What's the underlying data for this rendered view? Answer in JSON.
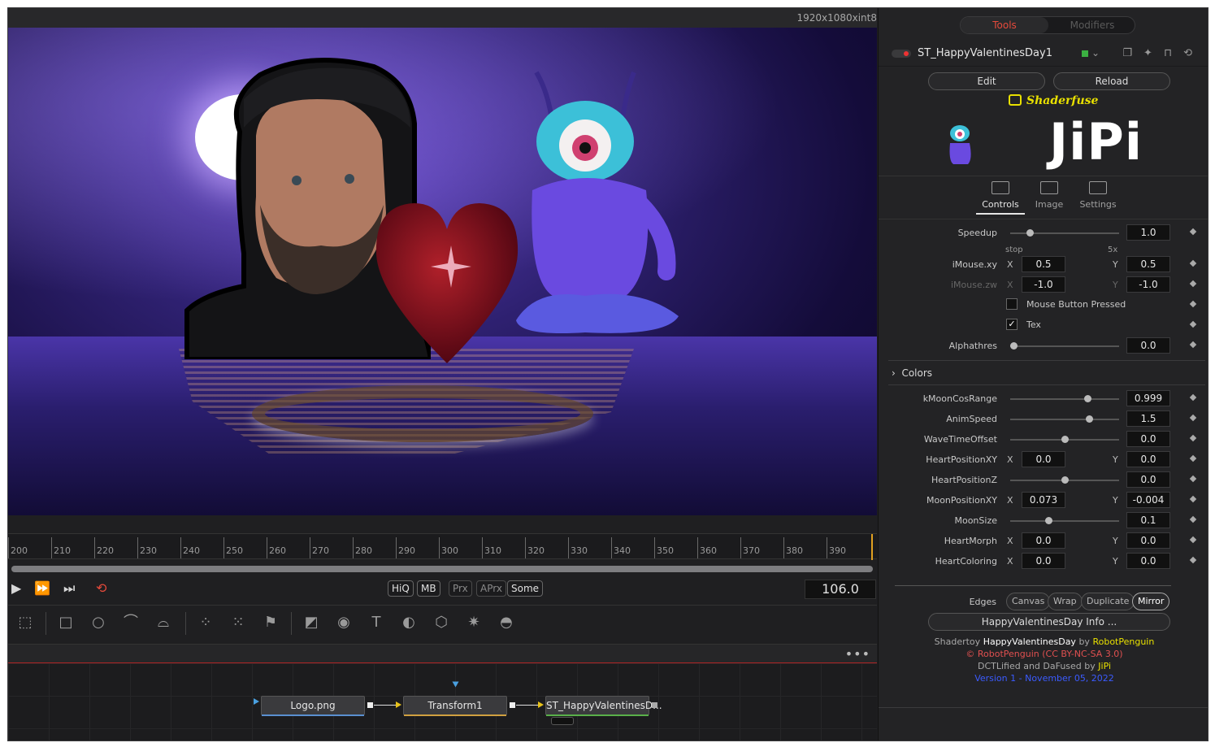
{
  "viewer": {
    "resolution": "1920x1080xint8",
    "ruler_ticks": [
      "200",
      "210",
      "220",
      "230",
      "240",
      "250",
      "260",
      "270",
      "280",
      "290",
      "300",
      "310",
      "320",
      "330",
      "340",
      "350",
      "360",
      "370",
      "380",
      "390"
    ]
  },
  "transport": {
    "buttons": [
      "HiQ",
      "MB",
      "Prx",
      "APrx",
      "Some"
    ],
    "frame": "106.0"
  },
  "flow": {
    "nodes": [
      {
        "label": "Logo.png",
        "color": "#5a8fd0"
      },
      {
        "label": "Transform1",
        "color": "#d0a040"
      },
      {
        "label": "ST_HappyValentinesD...",
        "color": "#5ab04a"
      }
    ]
  },
  "inspector": {
    "tabs": [
      "Tools",
      "Modifiers"
    ],
    "node_name": "ST_HappyValentinesDay1",
    "edit_label": "Edit",
    "reload_label": "Reload",
    "shaderfuse_label": "Shaderfuse",
    "logo_text": "JiPi",
    "subtabs": [
      "Controls",
      "Image",
      "Settings"
    ],
    "speedup": {
      "label": "Speedup",
      "value": "1.0",
      "min_label": "stop",
      "max_label": "5x",
      "level": 0.16
    },
    "imouse_xy": {
      "label": "iMouse.xy",
      "x": "0.5",
      "y": "0.5"
    },
    "imouse_zw": {
      "label": "iMouse.zw",
      "x": "-1.0",
      "y": "-1.0"
    },
    "mouse_pressed": {
      "label": "Mouse Button Pressed",
      "checked": false
    },
    "tex": {
      "label": "Tex",
      "checked": true
    },
    "alphathres": {
      "label": "Alphathres",
      "value": "0.0",
      "level": 0.0
    },
    "colors_section": "Colors",
    "params": [
      {
        "label": "kMoonCosRange",
        "type": "slider",
        "value": "0.999",
        "level": 0.73
      },
      {
        "label": "AnimSpeed",
        "type": "slider",
        "value": "1.5",
        "level": 0.74
      },
      {
        "label": "WaveTimeOffset",
        "type": "slider",
        "value": "0.0",
        "level": 0.5
      },
      {
        "label": "HeartPositionXY",
        "type": "xy",
        "x": "0.0",
        "y": "0.0"
      },
      {
        "label": "HeartPositionZ",
        "type": "slider",
        "value": "0.0",
        "level": 0.5
      },
      {
        "label": "MoonPositionXY",
        "type": "xy",
        "x": "0.073",
        "y": "-0.004"
      },
      {
        "label": "MoonSize",
        "type": "slider",
        "value": "0.1",
        "level": 0.34
      },
      {
        "label": "HeartMorph",
        "type": "xy",
        "x": "0.0",
        "y": "0.0"
      },
      {
        "label": "HeartColoring",
        "type": "xy",
        "x": "0.0",
        "y": "0.0"
      }
    ],
    "axis_x": "X",
    "axis_y": "Y",
    "edges_label": "Edges",
    "edges": [
      "Canvas",
      "Wrap",
      "Duplicate",
      "Mirror"
    ],
    "edges_selected": "Mirror",
    "info_button": "HappyValentinesDay Info ...",
    "credits": {
      "line1_prefix": "Shadertoy ",
      "line1_title": "HappyValentinesDay",
      "line1_by": " by ",
      "line1_author": "RobotPenguin",
      "line2": "© RobotPenguin (CC BY-NC-SA 3.0)",
      "line3_prefix": "DCTLified and DaFused by ",
      "line3_author": "JiPi",
      "line4": "Version 1 - November 05, 2022"
    },
    "colors": {
      "accent": "#e64a3b",
      "yellow": "#e8e000",
      "link": "#3b5bff",
      "license": "#e05050"
    }
  }
}
